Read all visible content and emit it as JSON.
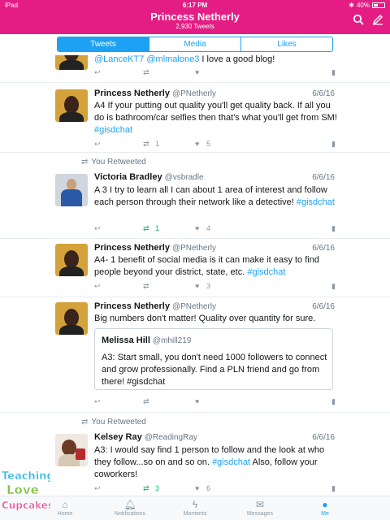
{
  "status_bar": {
    "carrier": "iPad",
    "time": "6:17 PM",
    "battery": "40%"
  },
  "header": {
    "title": "Princess Netherly",
    "subtitle": "2,930 Tweets",
    "brand_color": "#e31d83"
  },
  "tabs": [
    {
      "label": "Tweets",
      "active": true
    },
    {
      "label": "Media",
      "active": false
    },
    {
      "label": "Likes",
      "active": false
    }
  ],
  "tweets": [
    {
      "partial_text_pre": "@LanceKT7 @mlmalone3 ",
      "partial_text_post": "I love a good blog!"
    },
    {
      "name": "Princess Netherly",
      "handle": "@PNetherly",
      "date": "6/6/16",
      "text": "A4 If your putting out quality you'll get quality back. If all you do is bathroom/car selfies then that's what you'll get from SM! ",
      "hashtag": "#gisdchat",
      "retweets": "1",
      "likes": "5"
    },
    {
      "retweet_label": "You Retweeted",
      "name": "Victoria Bradley",
      "handle": "@vsbradle",
      "date": "6/6/16",
      "text": "A 3 I try to learn all I can about 1 area of interest and follow each person through their network like a detective! ",
      "hashtag": "#gisdchat",
      "retweets": "1",
      "likes": "4"
    },
    {
      "name": "Princess Netherly",
      "handle": "@PNetherly",
      "date": "6/6/16",
      "text": "A4- 1 benefit of social media is it can make it easy to find people beyond your district, state, etc. ",
      "hashtag": "#gisdchat",
      "likes": "3"
    },
    {
      "name": "Princess Netherly",
      "handle": "@PNetherly",
      "date": "6/6/16",
      "text": "Big numbers don't matter! Quality over quantity for sure.",
      "quote": {
        "name": "Melissa Hill",
        "handle": "@mhill219",
        "text": "A3: Start small, you don't need 1000 followers to connect and grow professionally. Find a PLN friend and go from there!  #gisdchat"
      }
    },
    {
      "retweet_label": "You Retweeted",
      "name": "Kelsey Ray",
      "handle": "@ReadingRay",
      "date": "6/6/16",
      "text_pre": "A3: I would say find 1 person to follow and the look at who they follow...so on and so on. ",
      "hashtag": "#gisdchat",
      "text_post": " Also, follow your coworkers!",
      "retweets": "3",
      "likes": "6"
    }
  ],
  "bottom_nav": [
    {
      "label": "Home",
      "icon": "home-icon"
    },
    {
      "label": "Notifications",
      "icon": "bell-icon"
    },
    {
      "label": "Moments",
      "icon": "lightning-icon"
    },
    {
      "label": "Messages",
      "icon": "envelope-icon"
    },
    {
      "label": "Me",
      "icon": "person-icon",
      "active": true
    }
  ],
  "watermark": {
    "line1": "Teaching",
    "line2": "Love",
    "line3": "Cupcakes"
  },
  "accent_color": "#1da1f2",
  "retweet_color": "#17bf63"
}
